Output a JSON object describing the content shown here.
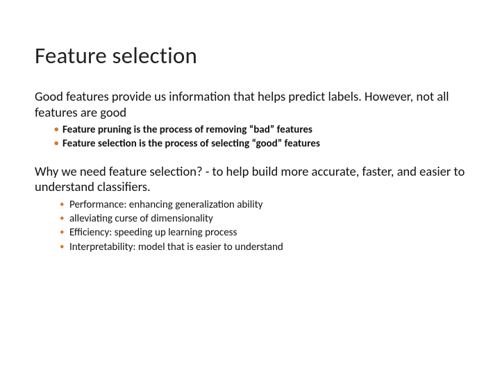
{
  "title": "Feature selection",
  "para1": "Good features provide us information that helps predict labels.  However, not all features are good",
  "sub1": [
    "Feature pruning is the process of removing “bad” features",
    "Feature selection is the process of selecting “good” features"
  ],
  "para2": "Why we need feature selection? - to help build more accurate, faster, and easier to understand classifiers.",
  "sub2": [
    "Performance: enhancing generalization ability",
    "alleviating curse of dimensionality",
    "Efficiency: speeding up learning process",
    "Interpretability: model that is easier to understand"
  ]
}
